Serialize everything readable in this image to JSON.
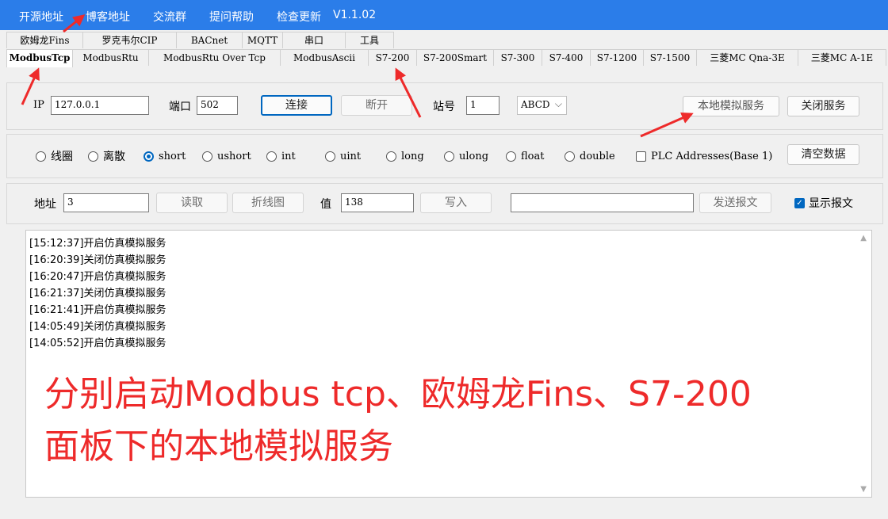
{
  "menubar": {
    "items": [
      "开源地址",
      "博客地址",
      "交流群",
      "提问帮助",
      "检查更新"
    ],
    "version": "V1.1.02"
  },
  "protocol_tabs": [
    "欧姆龙Fins",
    "罗克韦尔CIP",
    "BACnet",
    "MQTT",
    "串口",
    "工具"
  ],
  "device_tabs": [
    "ModbusTcp",
    "ModbusRtu",
    "ModbusRtu Over Tcp",
    "ModbusAscii",
    "S7-200",
    "S7-200Smart",
    "S7-300",
    "S7-400",
    "S7-1200",
    "S7-1500",
    "三菱MC Qna-3E",
    "三菱MC A-1E"
  ],
  "connection": {
    "ip_label": "IP",
    "ip_value": "127.0.0.1",
    "port_label": "端口",
    "port_value": "502",
    "connect_label": "连接",
    "disconnect_label": "断开",
    "station_label": "站号",
    "station_value": "1",
    "byte_order": "ABCD",
    "local_sim_label": "本地模拟服务",
    "close_service_label": "关闭服务"
  },
  "datatypes": {
    "options": [
      "线圈",
      "离散",
      "short",
      "ushort",
      "int",
      "uint",
      "long",
      "ulong",
      "float",
      "double"
    ],
    "selected": "short",
    "plc_addresses_label": "PLC Addresses(Base 1)",
    "clear_label": "清空数据"
  },
  "io": {
    "address_label": "地址",
    "address_value": "3",
    "read_label": "读取",
    "chart_label": "折线图",
    "value_label": "值",
    "value_value": "138",
    "write_label": "写入",
    "send_label": "发送报文",
    "show_message_label": "显示报文"
  },
  "log": [
    "[15:12:37]开启仿真模拟服务",
    "[16:20:39]关闭仿真模拟服务",
    "[16:20:47]开启仿真模拟服务",
    "[16:21:37]关闭仿真模拟服务",
    "[16:21:41]开启仿真模拟服务",
    "[14:05:49]关闭仿真模拟服务",
    "[14:05:52]开启仿真模拟服务"
  ],
  "annotation": {
    "line1": "分别启动Modbus tcp、欧姆龙Fins、S7-200",
    "line2": "面板下的本地模拟服务",
    "color": "#ee2a2a"
  },
  "colors": {
    "menubar": "#2b7de9",
    "accent": "#0067c0"
  }
}
